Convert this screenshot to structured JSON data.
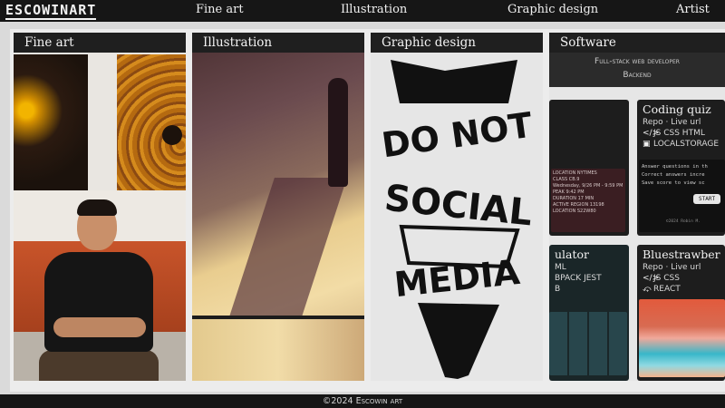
{
  "site": {
    "logo": "ESCOWINART"
  },
  "nav": {
    "fine_art": "Fine art",
    "illustration": "Illustration",
    "graphic_design": "Graphic design",
    "artist": "Artist"
  },
  "panels": {
    "fine_art": {
      "title": "Fine art"
    },
    "illustration": {
      "title": "Illustration"
    },
    "graphic_design": {
      "title": "Graphic design",
      "art_words": [
        "DO NOT",
        "SOCIAL",
        "MEDIA"
      ]
    },
    "software": {
      "title": "Software",
      "banner_line1": "Full-stack web developer",
      "banner_line2": "Backend",
      "cards": {
        "coding_quiz": {
          "title": "Coding quiz",
          "links": "Repo · Live url",
          "tech": "JS CSS HTML",
          "storage": "LOCALSTORAGE",
          "line1": "Answer questions in th",
          "line2": "Correct answers incre",
          "line3": "Save score to view sc",
          "start": "START",
          "footer": "©2024 Robin M."
        },
        "scheduler": {
          "location1": "LOCATION",
          "location1_val": "NYTIMES",
          "class": "CLASS",
          "class_val": "CB.9",
          "date": "Wednesday, 9/26 PM - 9:59 PM",
          "peak": "PEAK",
          "peak_val": "9:42 PM",
          "duration": "DURATION",
          "duration_val": "17 MIN",
          "active": "ACTIVE REGION",
          "active_val": "13198",
          "location2": "LOCATION",
          "location2_val": "S22W80"
        },
        "calculator": {
          "title": "ulator",
          "row1": "ML",
          "row2": "BPACK JEST",
          "row3": "B"
        },
        "bluestrawberry": {
          "title": "Bluestrawber",
          "links": "Repo · Live url",
          "tech": "JS CSS",
          "framework": "REACT"
        }
      }
    }
  },
  "footer": {
    "text": "©2024 Escowin art"
  },
  "colors": {
    "nav_bg": "#161616",
    "panel_title_bg": "#1f1f1f",
    "page_bg": "#dadada",
    "card_bg": "#1d1d1d"
  },
  "icons": [
    "code-icon",
    "database-icon",
    "share-icon"
  ]
}
